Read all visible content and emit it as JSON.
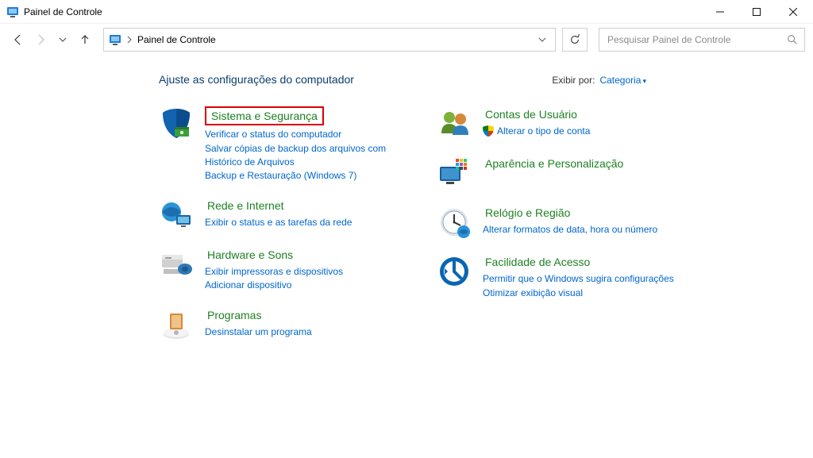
{
  "window": {
    "title": "Painel de Controle"
  },
  "nav": {
    "breadcrumb": "Painel de Controle",
    "search_placeholder": "Pesquisar Painel de Controle"
  },
  "header": {
    "title": "Ajuste as configurações do computador",
    "viewby_label": "Exibir por:",
    "viewby_value": "Categoria"
  },
  "categories": {
    "system": {
      "title": "Sistema e Segurança",
      "links": {
        "l1": "Verificar o status do computador",
        "l2": "Salvar cópias de backup dos arquivos com Histórico de Arquivos",
        "l3": "Backup e Restauração (Windows 7)"
      }
    },
    "network": {
      "title": "Rede e Internet",
      "links": {
        "l1": "Exibir o status e as tarefas da rede"
      }
    },
    "hardware": {
      "title": "Hardware e Sons",
      "links": {
        "l1": "Exibir impressoras e dispositivos",
        "l2": "Adicionar dispositivo"
      }
    },
    "programs": {
      "title": "Programas",
      "links": {
        "l1": "Desinstalar um programa"
      }
    },
    "users": {
      "title": "Contas de Usuário",
      "links": {
        "l1": "Alterar o tipo de conta"
      }
    },
    "appearance": {
      "title": "Aparência e Personalização"
    },
    "clock": {
      "title": "Relógio e Região",
      "links": {
        "l1": "Alterar formatos de data, hora ou número"
      }
    },
    "ease": {
      "title": "Facilidade de Acesso",
      "links": {
        "l1": "Permitir que o Windows sugira configurações",
        "l2": "Otimizar exibição visual"
      }
    }
  }
}
